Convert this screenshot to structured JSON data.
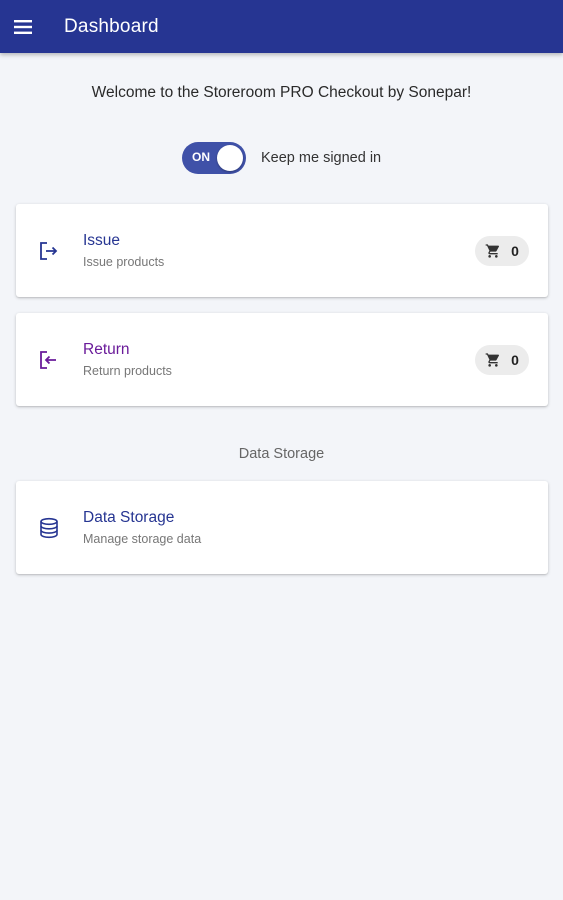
{
  "appbar": {
    "title": "Dashboard",
    "color": "#263592"
  },
  "welcome": "Welcome to the Storeroom PRO Checkout by Sonepar!",
  "signin": {
    "toggle_label": "ON",
    "label": "Keep me signed in",
    "toggle_color": "#3f51a8"
  },
  "cards": [
    {
      "title": "Issue",
      "subtitle": "Issue products",
      "icon": "issue-icon",
      "cart_count": "0",
      "title_color": "#263592"
    },
    {
      "title": "Return",
      "subtitle": "Return products",
      "icon": "return-icon",
      "cart_count": "0",
      "title_color": "#6a1b9a"
    }
  ],
  "section": {
    "label": "Data Storage"
  },
  "storage_card": {
    "title": "Data Storage",
    "subtitle": "Manage storage data",
    "icon": "database-icon"
  }
}
